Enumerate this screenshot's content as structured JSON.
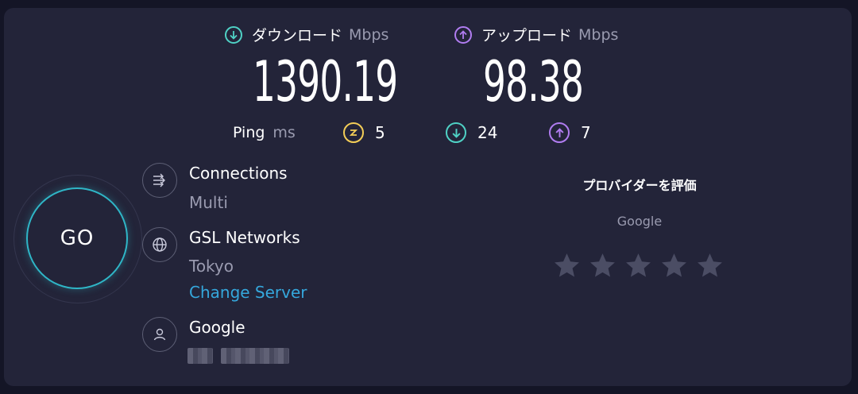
{
  "download": {
    "label": "ダウンロード",
    "unit": "Mbps",
    "value": "1390.19",
    "icon": "arrow-down-circle-icon",
    "color": "#4fd1c5"
  },
  "upload": {
    "label": "アップロード",
    "unit": "Mbps",
    "value": "98.38",
    "icon": "arrow-up-circle-icon",
    "color": "#b07cf0"
  },
  "ping": {
    "label": "Ping",
    "unit": "ms",
    "idle": "5",
    "download": "24",
    "upload": "7",
    "idle_color": "#f3cd57"
  },
  "go_label": "GO",
  "connections": {
    "title": "Connections",
    "value": "Multi",
    "icon": "connections-icon"
  },
  "server": {
    "title": "GSL Networks",
    "location": "Tokyo",
    "change_label": "Change Server",
    "icon": "globe-icon"
  },
  "provider": {
    "title": "Google",
    "icon": "user-icon"
  },
  "rating": {
    "title": "プロバイダーを評価",
    "provider": "Google",
    "stars": 5,
    "selected": 0
  }
}
